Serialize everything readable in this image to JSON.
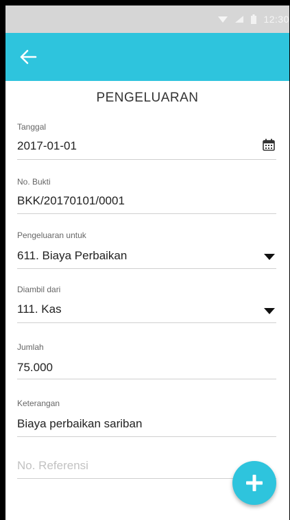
{
  "status_bar": {
    "time": "12:30"
  },
  "header": {
    "title": "PENGELUARAN"
  },
  "form": {
    "tanggal": {
      "label": "Tanggal",
      "value": "2017-01-01"
    },
    "no_bukti": {
      "label": "No. Bukti",
      "value": "BKK/20170101/0001"
    },
    "pengeluaran_untuk": {
      "label": "Pengeluaran untuk",
      "value": "611. Biaya Perbaikan"
    },
    "diambil_dari": {
      "label": "Diambil dari",
      "value": "111. Kas"
    },
    "jumlah": {
      "label": "Jumlah",
      "value": "75.000"
    },
    "keterangan": {
      "label": "Keterangan",
      "value": "Biaya perbaikan sariban"
    },
    "no_referensi": {
      "placeholder": "No. Referensi",
      "value": ""
    }
  },
  "colors": {
    "accent": "#2ec4dd",
    "status_bar": "#d6d6d6",
    "divider": "#cfcfcf"
  },
  "icons": {
    "back": "arrow-left-icon",
    "calendar": "calendar-icon",
    "dropdown": "triangle-down-icon",
    "fab": "plus-icon",
    "wifi": "wifi-icon",
    "signal": "signal-icon",
    "battery": "battery-icon"
  }
}
